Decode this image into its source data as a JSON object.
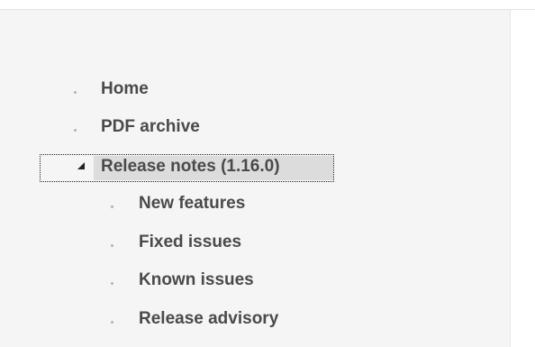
{
  "nav": {
    "items": [
      {
        "label": "Home"
      },
      {
        "label": "PDF archive"
      },
      {
        "label": "Release notes (1.16.0)",
        "expanded": true,
        "active": true,
        "children": [
          {
            "label": "New features"
          },
          {
            "label": "Fixed issues"
          },
          {
            "label": "Known issues"
          },
          {
            "label": "Release advisory"
          }
        ]
      }
    ]
  },
  "icons": {
    "bullet": "bullet-dot",
    "expanded": "triangle-expanded"
  },
  "colors": {
    "panel_bg": "#f5f5f5",
    "text": "#4a4a4a",
    "bullet": "#a9b3bd",
    "active_bg": "#dcdcdc"
  }
}
